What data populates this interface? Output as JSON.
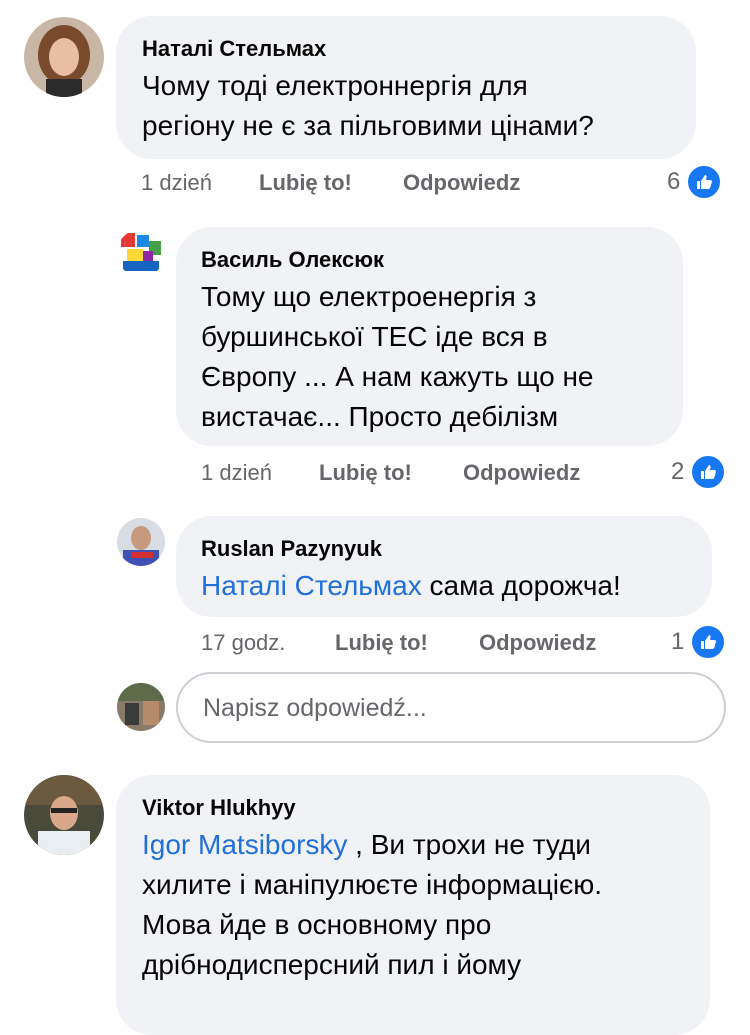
{
  "comments": [
    {
      "author": "Наталі Стельмах",
      "text_lines": [
        "Чому тоді електроннергія для",
        "регіону не є за пільговими цінами?"
      ],
      "time": "1 dzień",
      "like_label": "Lubię to!",
      "reply_label": "Odpowiedz",
      "likes": "6"
    },
    {
      "author": "Василь Олексюк",
      "text_lines": [
        "Тому що електроенергія з",
        "буршинської ТЕС іде вся в",
        "Європу ... А нам кажуть що не",
        "вистачає... Просто дебілізм"
      ],
      "time": "1 dzień",
      "like_label": "Lubię to!",
      "reply_label": "Odpowiedz",
      "likes": "2"
    },
    {
      "author": "Ruslan Pazynyuk",
      "mention": "Наталі Стельмах",
      "text": " сама дорожча!",
      "time": "17 godz.",
      "like_label": "Lubię to!",
      "reply_label": "Odpowiedz",
      "likes": "1"
    },
    {
      "author": "Viktor Hlukhyy",
      "mention": "Igor Matsiborsky",
      "text_first": " , Ви трохи не туди",
      "text_lines": [
        "хилите і маніпулюєте інформацією.",
        "Мова йде в основному про",
        "дрібнодисперсний пил і йому"
      ]
    }
  ],
  "reply_input": {
    "placeholder": "Napisz odpowiedź..."
  },
  "colors": {
    "bubble": "#f0f2f5",
    "mention": "#216fdb",
    "like": "#1877f2",
    "meta": "#65676b"
  },
  "icons": {
    "like": "thumbs-up-icon"
  }
}
